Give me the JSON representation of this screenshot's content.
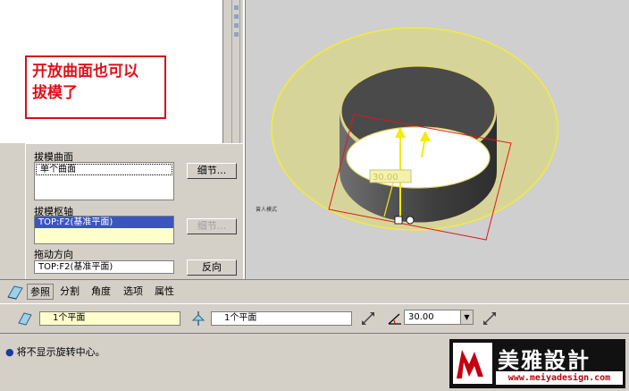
{
  "annotation": {
    "line1": "开放曲面也可以",
    "line2": "拔模了"
  },
  "panel": {
    "draft_surfaces_label": "拔模曲面",
    "draft_surfaces_value": "单个曲面",
    "details_button_1": "细节...",
    "draft_hinge_label": "拔模枢轴",
    "draft_hinge_value": "TOP:F2(基准平面)",
    "details_button_2": "细节...",
    "pull_direction_label": "拖动方向",
    "pull_direction_value": "TOP:F2(基准平面)",
    "flip_button": "反向"
  },
  "tabs": [
    {
      "label": "参照",
      "active": true
    },
    {
      "label": "分割"
    },
    {
      "label": "角度"
    },
    {
      "label": "选项"
    },
    {
      "label": "属性"
    }
  ],
  "controls": {
    "hinge_field": "1个平面",
    "direction_field": "1个平面",
    "angle_value": "30.00"
  },
  "viewport": {
    "dim_label": "30.00",
    "small_text": "曾人模式"
  },
  "status": {
    "message": "将不显示旋转中心。"
  },
  "logo": {
    "brand": "美雅設計",
    "url": "www.meiyadesign.com"
  },
  "colors": {
    "annotation_red": "#e0101a",
    "selection_blue": "#3a55c0",
    "surface_yellow": "#d7d49a"
  }
}
